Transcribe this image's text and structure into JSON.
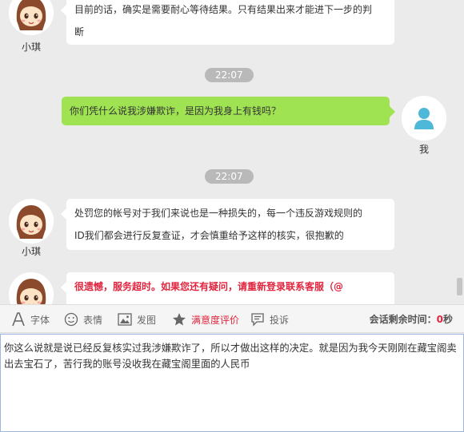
{
  "messages": [
    {
      "lines": [
        "目前的话，确实是需要耐心等待结果。只有结果出来才能进下一步的判",
        "断"
      ]
    },
    {
      "lines": [
        "你们凭什么说我涉嫌欺诈，是因为我身上有钱吗？"
      ]
    },
    {
      "lines": [
        "处罚您的帐号对于我们来说也是一种损失的，每一个违反游戏规则的",
        "ID我们都会进行反复查证，才会慎重给予这样的核实，很抱歉的"
      ]
    },
    {
      "lines": [
        "很遗憾，服务超时。如果您还有疑问，请重新登录联系客服（@"
      ]
    }
  ],
  "names": {
    "agent": "小琪",
    "me": "我"
  },
  "times": [
    "22:07",
    "22:07"
  ],
  "toolbar": {
    "font": "字体",
    "emoji": "表情",
    "image": "发图",
    "rating": "满意度评价",
    "complaint": "投诉",
    "timer_label": "会话剩余时间：",
    "timer_value": "0",
    "timer_unit": "秒"
  },
  "input": {
    "value": "你这么说就是说已经反复核实过我涉嫌欺诈了，所以才做出这样的决定。就是因为我今天刚刚在藏宝阁卖出去宝石了，苦行我的账号没收我在藏宝阁里面的人民币"
  },
  "colors": {
    "chat_bg": "#ebebeb",
    "my_bubble": "#9fe353",
    "agent_bubble": "#ffffff",
    "warning": "#e0263f",
    "user_avatar": "#4db8d8"
  },
  "icons": [
    "girl-avatar-icon",
    "user-avatar-icon",
    "font-icon",
    "emoji-icon",
    "image-icon",
    "star-icon",
    "complaint-icon"
  ]
}
